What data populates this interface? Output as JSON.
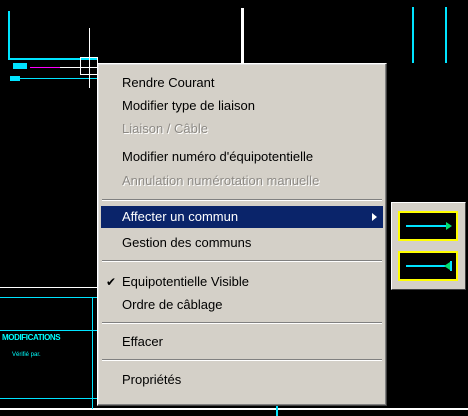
{
  "drawing": {
    "title_block_label": "MODIFICATIONS",
    "title_block_sub": "Vérifié par."
  },
  "context_menu": {
    "items": [
      {
        "label": "Rendre Courant",
        "enabled": true
      },
      {
        "label": "Modifier type de liaison",
        "enabled": true
      },
      {
        "label": "Liaison / Câble",
        "enabled": false
      },
      {
        "label": "Modifier numéro d'équipotentielle",
        "enabled": true
      },
      {
        "label": "Annulation numérotation manuelle",
        "enabled": false
      },
      {
        "label": "Affecter un commun",
        "enabled": true,
        "highlighted": true,
        "has_submenu": true
      },
      {
        "label": "Gestion des communs",
        "enabled": true
      },
      {
        "label": "Equipotentielle Visible",
        "enabled": true,
        "checked": true
      },
      {
        "label": "Ordre de câblage",
        "enabled": true
      },
      {
        "label": "Effacer",
        "enabled": true
      },
      {
        "label": "Propriétés",
        "enabled": true
      }
    ]
  },
  "submenu": {
    "options": [
      {
        "icon": "line-arrow-right-icon"
      },
      {
        "icon": "line-arrow-left-icon"
      }
    ]
  },
  "colors": {
    "menu_bg": "#d4d0c8",
    "highlight": "#0a246a",
    "cad_line": "#00e4ff",
    "swatch_border": "#ffff00"
  }
}
